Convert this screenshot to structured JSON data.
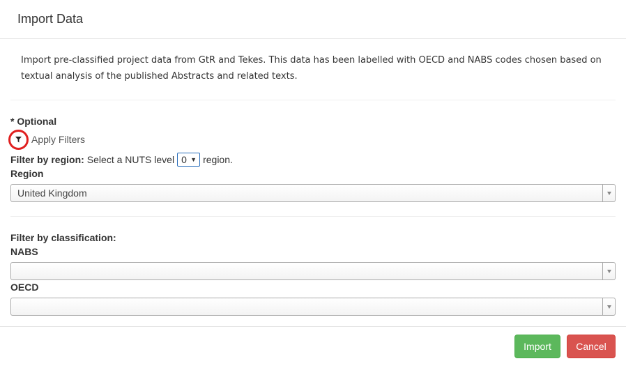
{
  "modal": {
    "title": "Import Data",
    "intro": "Import pre-classified project data from GtR and Tekes. This data has been labelled with OECD and NABS codes chosen based on textual analysis of the published Abstracts and related texts."
  },
  "filters": {
    "optional_label": "* Optional",
    "apply_filters_label": "Apply Filters",
    "filter_icon": "filter-icon",
    "highlight_color": "#e02020",
    "region": {
      "filter_label": "Filter by region:",
      "text_before": "Select a NUTS level",
      "nuts_level": "0",
      "text_after": "region.",
      "field_label": "Region",
      "value": "United Kingdom"
    },
    "classification": {
      "filter_label": "Filter by classification:",
      "nabs_label": "NABS",
      "nabs_value": "",
      "oecd_label": "OECD",
      "oecd_value": ""
    }
  },
  "footer": {
    "import_label": "Import",
    "cancel_label": "Cancel",
    "import_color": "#5cb85c",
    "cancel_color": "#d9534f"
  }
}
